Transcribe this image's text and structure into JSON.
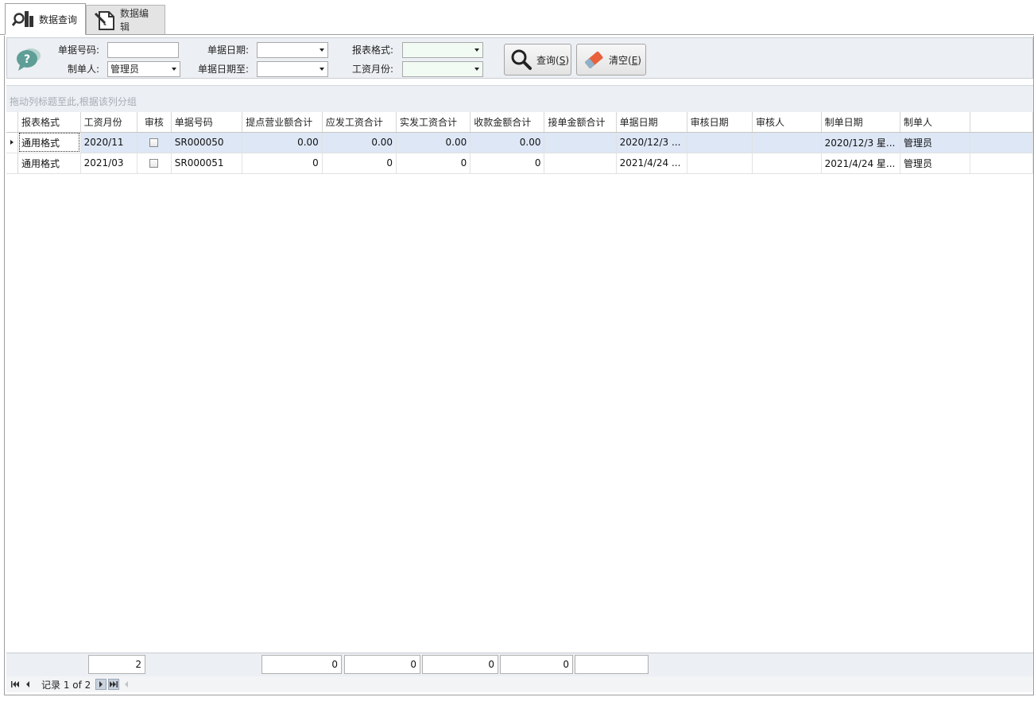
{
  "tabs": [
    {
      "label": "数据查询",
      "active": true,
      "icon": "magnify-chart-icon"
    },
    {
      "label": "数据编辑",
      "active": false,
      "icon": "edit-document-icon"
    }
  ],
  "query": {
    "bill_no_label": "单据号码:",
    "bill_no_value": "",
    "maker_label": "制单人:",
    "maker_value": "管理员",
    "bill_date_label": "单据日期:",
    "bill_date_value": "",
    "bill_date_to_label": "单据日期至:",
    "bill_date_to_value": "",
    "report_format_label": "报表格式:",
    "report_format_value": "",
    "salary_month_label": "工资月份:",
    "salary_month_value": "",
    "search_label": "查询(",
    "search_mnemonic": "S",
    "search_close": ")",
    "clear_label": "清空(",
    "clear_mnemonic": "E",
    "clear_close": ")"
  },
  "group_hint": "拖动列标题至此,根据该列分组",
  "grid": {
    "columns": [
      "报表格式",
      "工资月份",
      "审核",
      "单据号码",
      "提点营业额合计",
      "应发工资合计",
      "实发工资合计",
      "收款金额合计",
      "接单金额合计",
      "单据日期",
      "审核日期",
      "审核人",
      "制单日期",
      "制单人"
    ],
    "rows": [
      {
        "format": "通用格式",
        "month": "2020/11",
        "audited": false,
        "bill_no": "SR000050",
        "commission": "0.00",
        "payable": "0.00",
        "actual": "0.00",
        "received": "0.00",
        "order_amt": "",
        "bill_date": "2020/12/3 ...",
        "audit_date": "",
        "auditor": "",
        "make_date": "2020/12/3 星...",
        "maker": "管理员"
      },
      {
        "format": "通用格式",
        "month": "2021/03",
        "audited": false,
        "bill_no": "SR000051",
        "commission": "0",
        "payable": "0",
        "actual": "0",
        "received": "0",
        "order_amt": "",
        "bill_date": "2021/4/24 ...",
        "audit_date": "",
        "auditor": "",
        "make_date": "2021/4/24 星...",
        "maker": "管理员"
      }
    ]
  },
  "footer": {
    "month_count": "2",
    "commission_sum": "0",
    "payable_sum": "0",
    "actual_sum": "0",
    "received_sum": "0",
    "order_sum": ""
  },
  "navigator": {
    "record_text": "记录 1 of 2"
  }
}
